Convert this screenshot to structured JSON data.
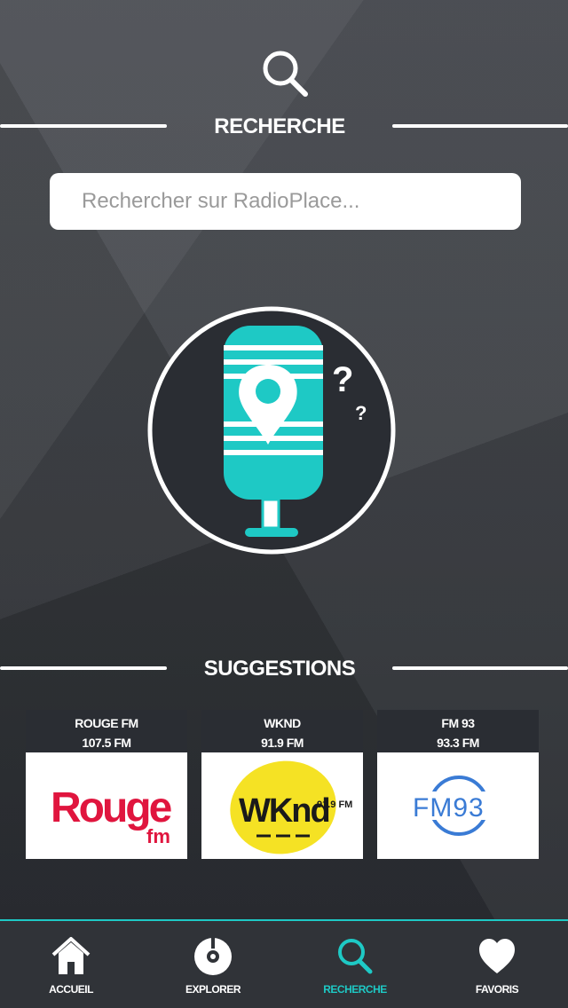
{
  "header": {
    "icon": "search-icon",
    "title": "RECHERCHE"
  },
  "search": {
    "placeholder": "Rechercher sur RadioPlace...",
    "value": ""
  },
  "illustration": {
    "icon": "microphone-location-question-icon",
    "accent": "#1ec9c5"
  },
  "suggestions": {
    "title": "SUGGESTIONS",
    "items": [
      {
        "name": "ROUGE FM",
        "frequency": "107.5 FM",
        "logo": "rouge-fm-logo",
        "logo_text": "Rouge",
        "logo_sub": "fm"
      },
      {
        "name": "WKND",
        "frequency": "91.9 FM",
        "logo": "wknd-logo",
        "logo_text": "WKnd",
        "logo_sub": "91.9 FM"
      },
      {
        "name": "FM 93",
        "frequency": "93.3 FM",
        "logo": "fm93-logo",
        "logo_text": "FM93"
      }
    ]
  },
  "tabbar": {
    "active": "RECHERCHE",
    "accent": "#1ec9c5",
    "tabs": [
      {
        "label": "ACCUEIL",
        "icon": "home-icon"
      },
      {
        "label": "EXPLORER",
        "icon": "disc-icon"
      },
      {
        "label": "RECHERCHE",
        "icon": "search-icon"
      },
      {
        "label": "FAVORIS",
        "icon": "heart-icon"
      }
    ]
  }
}
